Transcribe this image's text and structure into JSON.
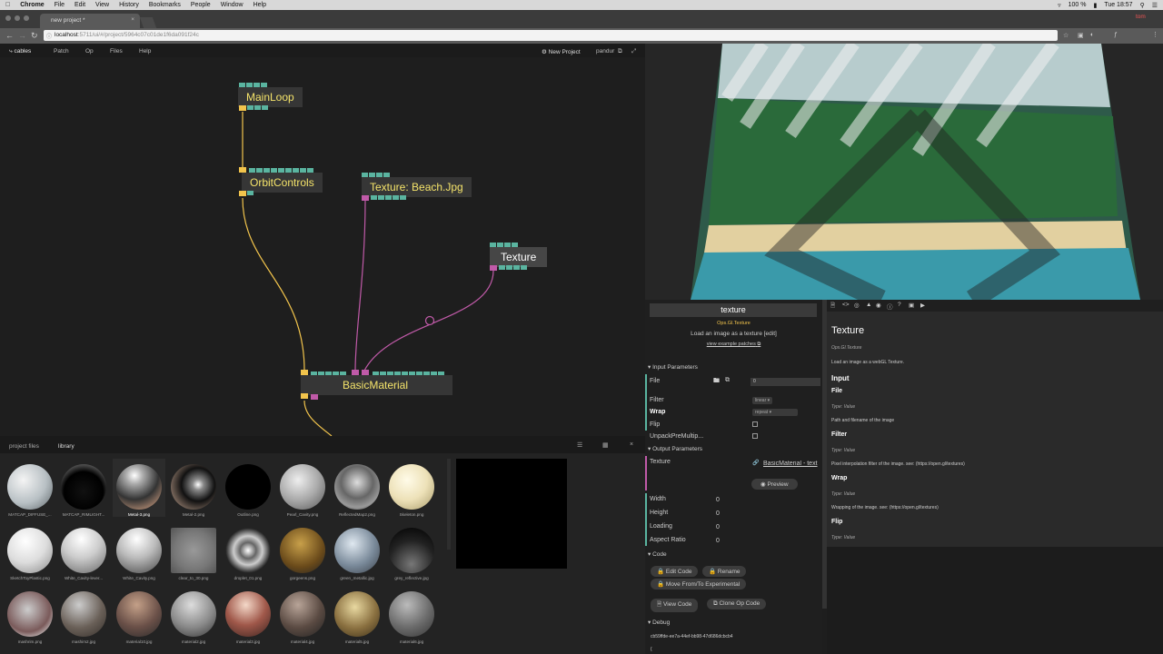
{
  "menubar": {
    "app": "Chrome",
    "items": [
      "File",
      "Edit",
      "View",
      "History",
      "Bookmarks",
      "People",
      "Window",
      "Help"
    ],
    "battery": "100 %",
    "clock": "Tue 18:57"
  },
  "browser": {
    "tab_title": "new project *",
    "url_host": "localhost",
    "url_path": ":5711/ui/#/project/5964c07c01de1f6da091f24c",
    "user": "tom"
  },
  "app": {
    "logo": "cables",
    "menu": [
      "Patch",
      "Op",
      "Files",
      "Help"
    ],
    "project_name": "New Project",
    "user": "pandur"
  },
  "ops": {
    "mainloop": "MainLoop",
    "orbit": "OrbitControls",
    "beach": "Texture: Beach.Jpg",
    "texture": "Texture",
    "material": "BasicMaterial"
  },
  "library": {
    "tabs": [
      "project files",
      "library"
    ],
    "files": [
      "MATCAP_DIFFUSE_...",
      "MATCAP_RIMLIGHT...",
      "Metal-3.png",
      "Metal-2.png",
      "Outline.png",
      "Pearl_Cavity.png",
      "ReflectedMap2.png",
      "Skeleton.png",
      "SketchToyPlastic.png",
      "White_Cavity-lever...",
      "White_Cavity.png",
      "clear_to_30.png",
      "droplet_01.png",
      "gorgeens.png",
      "green_metallic.jpg",
      "grey_reflective.jpg",
      "mashrim.png",
      "mashim2.jpg",
      "material10.jpg",
      "material2.jpg",
      "material3.jpg",
      "material4.jpg",
      "material5.jpg",
      "material6.jpg"
    ]
  },
  "op_panel": {
    "name": "texture",
    "class": "Ops.Gl.Texture",
    "description": "Load an image as a texture",
    "edit": "[edit]",
    "examples": "view example patches",
    "input_header": "Input Parameters",
    "inputs": [
      {
        "label": "File",
        "value": "0"
      },
      {
        "label": "Filter",
        "value": "linear"
      },
      {
        "label": "Wrap",
        "value": "repeat"
      },
      {
        "label": "Flip",
        "value": ""
      },
      {
        "label": "UnpackPreMultip...",
        "value": ""
      }
    ],
    "output_header": "Output Parameters",
    "outputs": {
      "texture_label": "Texture",
      "texture_link": "BasicMaterial - text",
      "preview": "Preview",
      "width_label": "Width",
      "width": "0",
      "height_label": "Height",
      "height": "0",
      "loading_label": "Loading",
      "loading": "0",
      "aspect_label": "Aspect Ratio",
      "aspect": "0"
    },
    "code_header": "Code",
    "buttons": {
      "edit_code": "Edit Code",
      "rename": "Rename",
      "move": "Move From/To Experimental",
      "view_code": "View Code",
      "clone": "Clone Op Code"
    },
    "debug_header": "Debug",
    "debug_id": "cb59ffde-ee7a-44ef-bb98-47d686dcbcb4",
    "debug_brace": "{"
  },
  "doc": {
    "title": "Texture",
    "class": "Ops.Gl.Texture",
    "desc": "Load an image as a webGL Texture.",
    "input": "Input",
    "file": "File",
    "file_type": "Type: Value",
    "file_desc": "Path and filename of the image",
    "filter": "Filter",
    "filter_type": "Type: Value",
    "filter_desc": "Pixel interpolation filter of the image. see: (https://open.gl/textures)",
    "wrap": "Wrap",
    "wrap_type": "Type: Value",
    "wrap_desc": "Wrapping of the image. see: (https://open.gl/textures)",
    "flip": "Flip",
    "flip_type": "Type: Value"
  },
  "colors": {
    "accent_yellow": "#f2c44c",
    "port_green": "#5ab4a0",
    "port_magenta": "#c05aa8",
    "selection": "#3fb3a0"
  }
}
